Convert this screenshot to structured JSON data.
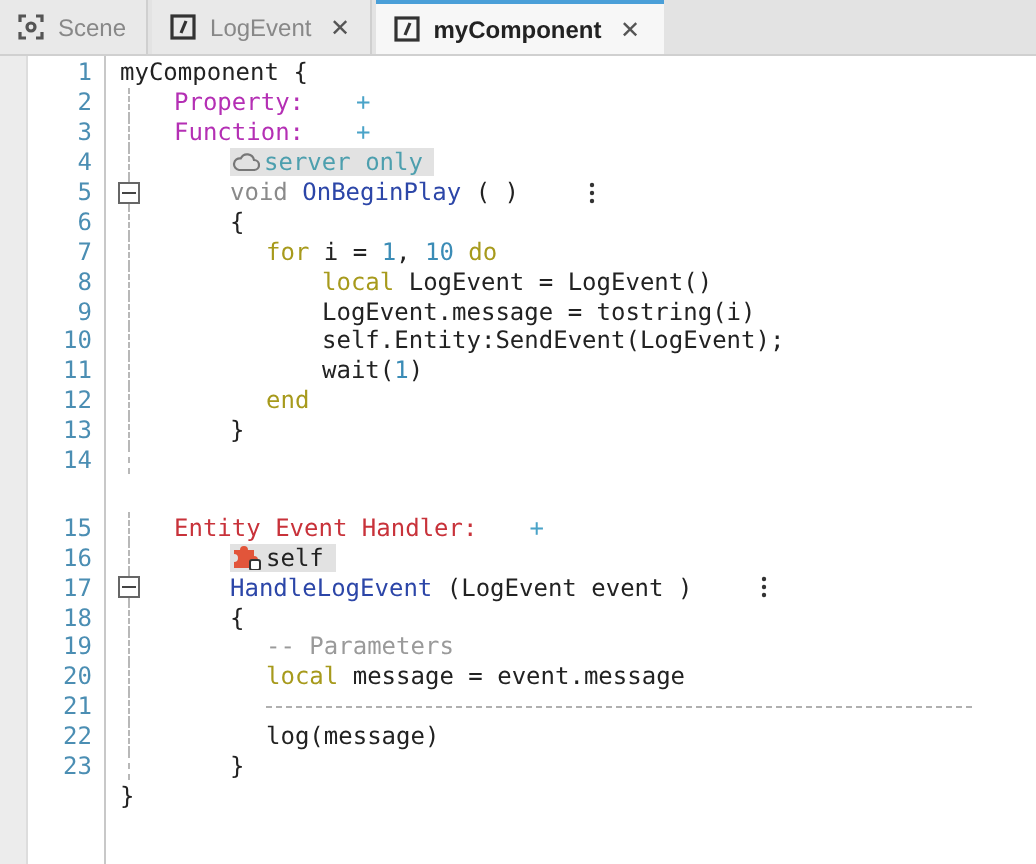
{
  "tabs": [
    {
      "label": "Scene",
      "kind": "scene",
      "closable": false,
      "selected": false
    },
    {
      "label": "LogEvent",
      "kind": "script",
      "closable": true,
      "selected": false
    },
    {
      "label": "myComponent",
      "kind": "script",
      "closable": true,
      "selected": true
    }
  ],
  "close_glyph": "✕",
  "editor": {
    "lines": [
      {
        "num": "1",
        "kind": "code",
        "tokens": [
          {
            "kind": "plain",
            "text": "myComponent {"
          }
        ],
        "children": [
          {
            "num": "2",
            "kind": "code",
            "tokens": [
              {
                "kind": "property",
                "text": "Property:"
              }
            ],
            "add": "+"
          },
          {
            "num": "3",
            "kind": "code",
            "tokens": [
              {
                "kind": "property",
                "text": "Function:"
              }
            ],
            "add": "+",
            "children": [
              {
                "num": "4",
                "kind": "badge",
                "badge": {
                  "kind": "cloud",
                  "text": "server only"
                }
              },
              {
                "num": "5",
                "kind": "code",
                "fold": true,
                "menu": true,
                "tokens": [
                  {
                    "kind": "type",
                    "text": "void "
                  },
                  {
                    "kind": "function",
                    "text": "OnBeginPlay"
                  },
                  {
                    "kind": "plain",
                    "text": " ( )"
                  }
                ]
              },
              {
                "num": "6",
                "kind": "code",
                "tokens": [
                  {
                    "kind": "plain",
                    "text": "{"
                  }
                ],
                "children": [
                  {
                    "num": "7",
                    "kind": "code",
                    "tokens": [
                      {
                        "kind": "keyword",
                        "text": "for"
                      },
                      {
                        "kind": "plain",
                        "text": " i = "
                      },
                      {
                        "kind": "number",
                        "text": "1"
                      },
                      {
                        "kind": "plain",
                        "text": ", "
                      },
                      {
                        "kind": "number",
                        "text": "10"
                      },
                      {
                        "kind": "keyword",
                        "text": " do"
                      }
                    ],
                    "children": [
                      {
                        "num": "8",
                        "kind": "code",
                        "tokens": [
                          {
                            "kind": "keyword",
                            "text": "local"
                          },
                          {
                            "kind": "plain",
                            "text": " LogEvent = LogEvent()"
                          }
                        ]
                      },
                      {
                        "num": "9",
                        "kind": "code",
                        "tokens": [
                          {
                            "kind": "plain",
                            "text": "LogEvent.message = tostring(i)"
                          }
                        ]
                      },
                      {
                        "num": "10",
                        "kind": "code",
                        "tokens": [
                          {
                            "kind": "plain",
                            "text": "self.Entity:SendEvent(LogEvent);"
                          }
                        ]
                      },
                      {
                        "num": "11",
                        "kind": "code",
                        "tokens": [
                          {
                            "kind": "plain",
                            "text": "wait("
                          },
                          {
                            "kind": "number",
                            "text": "1"
                          },
                          {
                            "kind": "plain",
                            "text": ")"
                          }
                        ]
                      }
                    ]
                  },
                  {
                    "num": "12",
                    "kind": "code",
                    "tokens": [
                      {
                        "kind": "keyword",
                        "text": "end"
                      }
                    ]
                  }
                ]
              },
              {
                "num": "13",
                "kind": "code",
                "tokens": [
                  {
                    "kind": "plain",
                    "text": "}"
                  }
                ]
              }
            ]
          },
          {
            "num": "14",
            "kind": "code"
          },
          {
            "num": "15",
            "kind": "code",
            "spaced_before": true,
            "tokens": [
              {
                "kind": "handler",
                "text": "Entity Event Handler:"
              }
            ],
            "add": "+",
            "children": [
              {
                "num": "16",
                "kind": "badge",
                "badge": {
                  "kind": "puzzle",
                  "text": "self"
                }
              },
              {
                "num": "17",
                "kind": "code",
                "fold": true,
                "menu": true,
                "tokens": [
                  {
                    "kind": "function",
                    "text": "HandleLogEvent"
                  },
                  {
                    "kind": "plain",
                    "text": " (LogEvent event )"
                  }
                ]
              },
              {
                "num": "18",
                "kind": "code",
                "tokens": [
                  {
                    "kind": "plain",
                    "text": "{"
                  }
                ],
                "children": [
                  {
                    "num": "19",
                    "kind": "code",
                    "tokens": [
                      {
                        "kind": "comment",
                        "text": "-- Parameters"
                      }
                    ]
                  },
                  {
                    "num": "20",
                    "kind": "code",
                    "tokens": [
                      {
                        "kind": "keyword",
                        "text": "local"
                      },
                      {
                        "kind": "plain",
                        "text": " message = event.message"
                      }
                    ]
                  },
                  {
                    "num": "21",
                    "kind": "rule"
                  },
                  {
                    "num": "22",
                    "kind": "code",
                    "tokens": [
                      {
                        "kind": "plain",
                        "text": "log(message)"
                      }
                    ]
                  }
                ]
              },
              {
                "num": "23",
                "kind": "code",
                "tokens": [
                  {
                    "kind": "plain",
                    "text": "}"
                  }
                ]
              }
            ]
          }
        ]
      },
      {
        "kind": "code",
        "tokens": [
          {
            "kind": "plain",
            "text": "}"
          }
        ]
      }
    ]
  }
}
